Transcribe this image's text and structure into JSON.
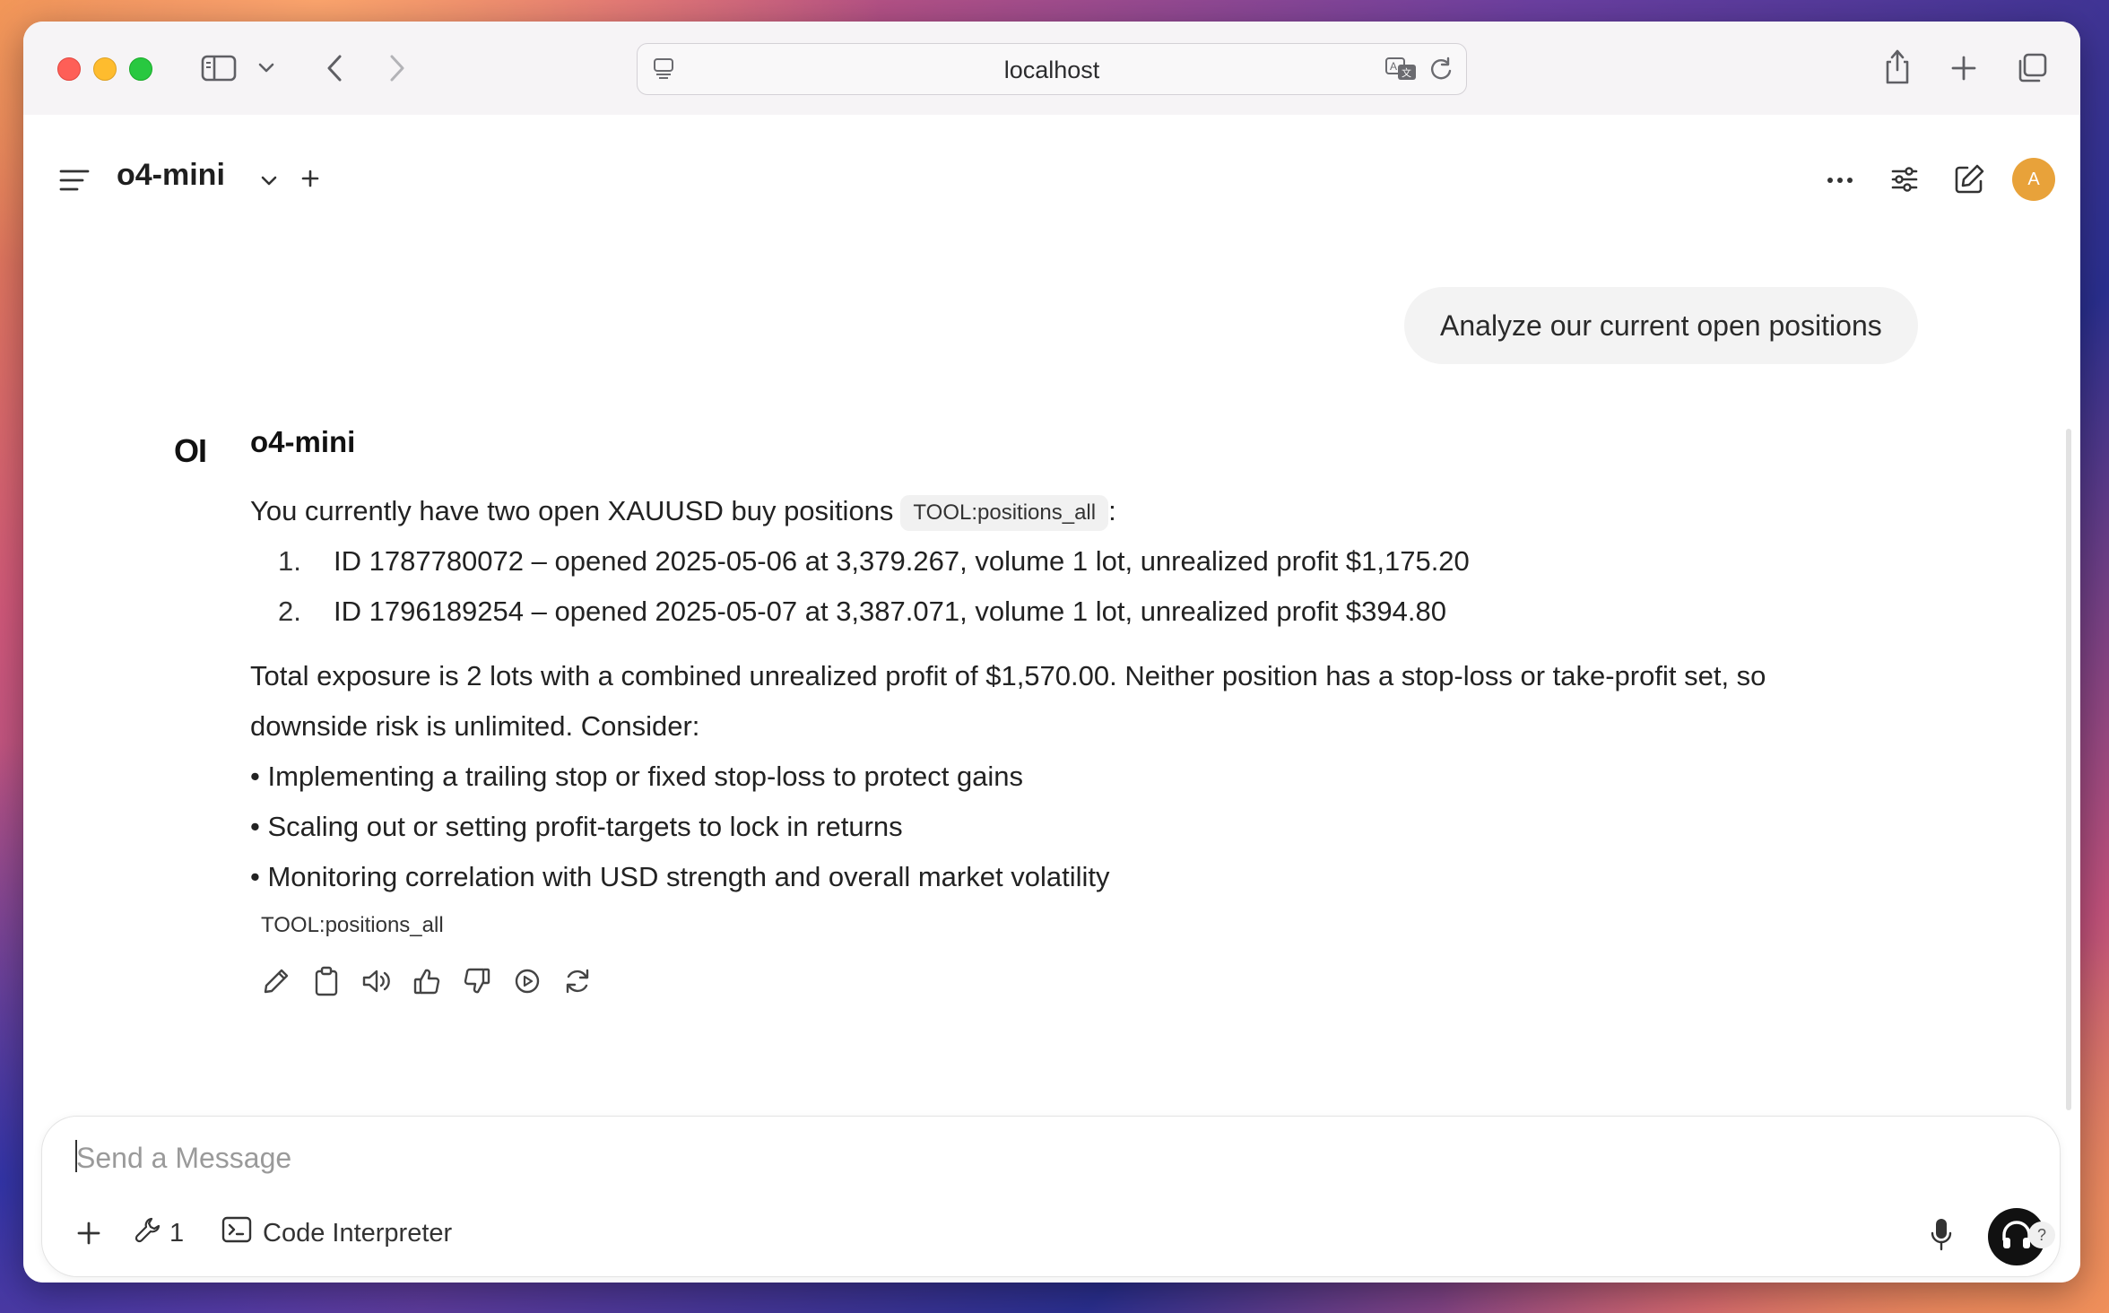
{
  "browser": {
    "url": "localhost"
  },
  "header": {
    "model_name": "o4-mini",
    "avatar_initial": "A"
  },
  "conversation": {
    "user_message": "Analyze our current open positions",
    "assistant_name": "o4-mini",
    "assistant_logo": "OI",
    "intro": "You currently have two open XAUUSD buy positions",
    "intro_suffix": ":",
    "tool_tag": "TOOL:positions_all",
    "positions": [
      {
        "num": "1.",
        "text": "ID 1787780072 – opened 2025-05-06 at 3,379.267, volume 1 lot, unrealized profit $1,175.20"
      },
      {
        "num": "2.",
        "text": "ID 1796189254 – opened 2025-05-07 at 3,387.071, volume 1 lot, unrealized profit $394.80"
      }
    ],
    "summary_line1": "Total exposure is 2 lots with a combined unrealized profit of $1,570.00. Neither position has a stop-loss or take-profit set, so",
    "summary_line2": "downside risk is unlimited. Consider:",
    "bullets": [
      "• Implementing a trailing stop or fixed stop-loss to protect gains",
      "• Scaling out or setting profit-targets to lock in returns",
      "• Monitoring correlation with USD strength and overall market volatility"
    ],
    "footer_tool": "TOOL:positions_all",
    "action_icons": [
      "pencil-icon",
      "clipboard-icon",
      "speaker-icon",
      "thumbs-up-icon",
      "thumbs-down-icon",
      "play-circle-icon",
      "refresh-icon"
    ]
  },
  "composer": {
    "placeholder": "Send a Message",
    "tools_count": "1",
    "code_interpreter_label": "Code Interpreter"
  },
  "help_label": "?"
}
